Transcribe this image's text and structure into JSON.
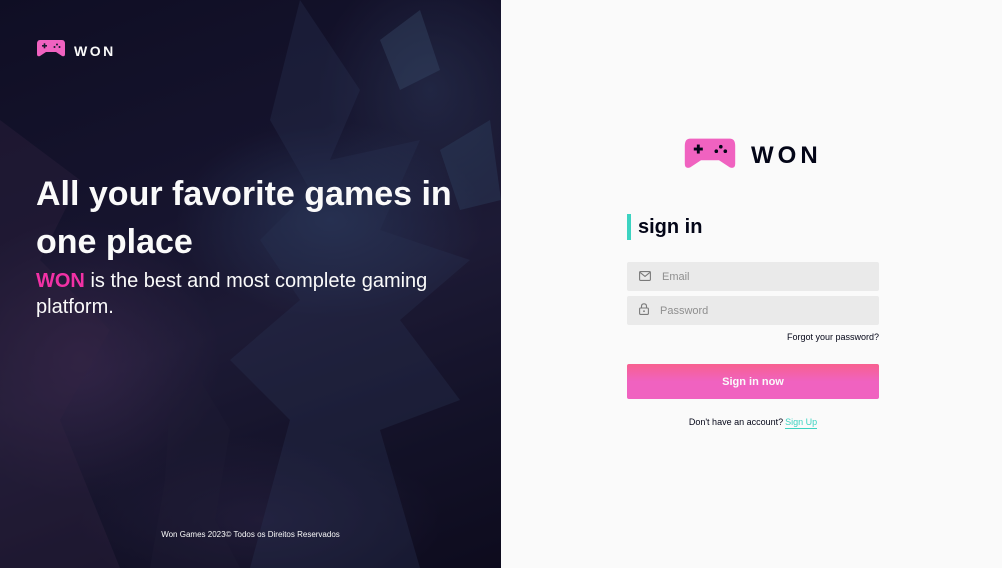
{
  "brand": {
    "name": "WON",
    "icon": "gamepad-icon",
    "colors": {
      "pink": "#f231a5",
      "pinkLight": "#f062c0",
      "coral": "#ff5f5f",
      "teal": "#3cd3c1",
      "dark": "#030517"
    }
  },
  "hero": {
    "title": "All your favorite games in one place",
    "subtitle_accent": "WON",
    "subtitle_rest": " is the best and most complete gaming platform.",
    "footer": "Won Games 2023© Todos os Direitos Reservados"
  },
  "signin": {
    "title": "sign in",
    "email": {
      "placeholder": "Email",
      "value": "",
      "icon": "mail-icon"
    },
    "password": {
      "placeholder": "Password",
      "value": "",
      "icon": "lock-icon"
    },
    "forgot_label": "Forgot your password?",
    "submit_label": "Sign in now",
    "signup_prompt": "Don't have an account?",
    "signup_link": "Sign Up"
  }
}
